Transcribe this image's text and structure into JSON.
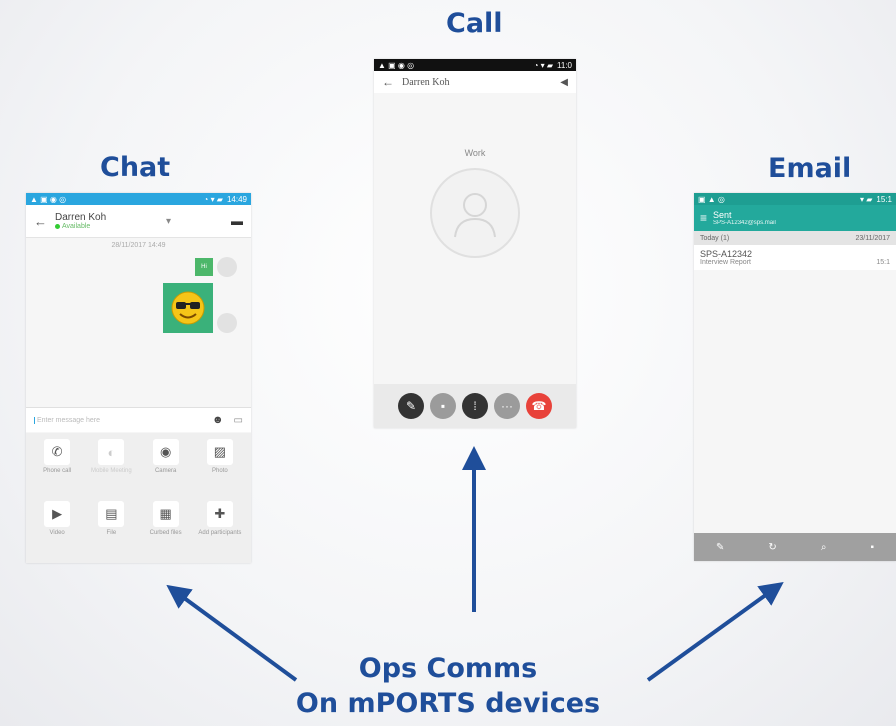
{
  "headings": {
    "call": "Call",
    "chat": "Chat",
    "email": "Email"
  },
  "caption": {
    "line1": "Ops Comms",
    "line2": "On mPORTS devices"
  },
  "chat": {
    "status_right": "14:49",
    "contact_name": "Darren Koh",
    "availability": "Available",
    "date": "28/11/2017 14:49",
    "sent_short": "Hi",
    "composer_placeholder": "Enter message here",
    "attachments": [
      {
        "label": "Phone call",
        "icon": "phone-icon",
        "glyph": "✆"
      },
      {
        "label": "Mobile Meeting",
        "icon": "meeting-icon",
        "glyph": "◐"
      },
      {
        "label": "Camera",
        "icon": "camera-icon",
        "glyph": "◉"
      },
      {
        "label": "Photo",
        "icon": "photo-icon",
        "glyph": "▨"
      },
      {
        "label": "Video",
        "icon": "video-icon",
        "glyph": "▶"
      },
      {
        "label": "File",
        "icon": "file-icon",
        "glyph": "▤"
      },
      {
        "label": "Curbed files",
        "icon": "folder-icon",
        "glyph": "▦"
      },
      {
        "label": "Add participants",
        "icon": "add-person-icon",
        "glyph": "✚"
      }
    ]
  },
  "call": {
    "status_right": "11:0",
    "contact_name": "Darren Koh",
    "label": "Work"
  },
  "email": {
    "status_right": "15:1",
    "folder": "Sent",
    "account": "SPS-A12342@sps.mail",
    "section": "Today (1)",
    "section_date": "23/11/2017",
    "item_from": "SPS-A12342",
    "item_subject": "Interview Report",
    "item_time": "15:1"
  },
  "colors": {
    "accent": "#1f4e9a",
    "chat_bar": "#2aa6df",
    "email_bar": "#23a99c",
    "hangup": "#e8423a"
  }
}
